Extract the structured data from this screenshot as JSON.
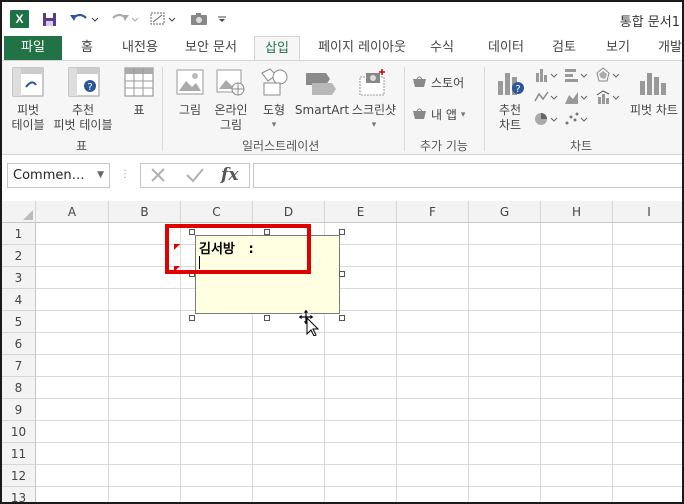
{
  "window": {
    "title": "통합 문서1"
  },
  "quick_access": {
    "icons": [
      "excel-logo",
      "save-icon",
      "undo-icon",
      "redo-icon",
      "shapes-icon",
      "camera-icon",
      "customize-icon"
    ]
  },
  "tabs": [
    "파일",
    "홈",
    "내전용",
    "보안 문서",
    "삽입",
    "페이지 레이아웃",
    "수식",
    "데이터",
    "검토",
    "보기",
    "개발"
  ],
  "active_tab": "삽입",
  "ribbon": {
    "groups": {
      "tables": "표",
      "illustrations": "일러스트레이션",
      "addins": "추가 기능",
      "charts": "차트"
    },
    "items": {
      "pivot_table_1": "피벗",
      "pivot_table_2": "테이블",
      "recommended_pivot_1": "추천",
      "recommended_pivot_2": "피벗 테이블",
      "table": "표",
      "picture": "그림",
      "online_picture_1": "온라인",
      "online_picture_2": "그림",
      "shapes": "도형",
      "smartart": "SmartArt",
      "screenshot": "스크린샷",
      "store": "스토어",
      "my_apps": "내 앱",
      "recommended_charts_1": "추천",
      "recommended_charts_2": "차트",
      "pivot_chart": "피벗 차트"
    }
  },
  "formula_bar": {
    "name_box": "Commen…",
    "fx_label": "fx",
    "formula": ""
  },
  "sheet": {
    "columns": [
      "A",
      "B",
      "C",
      "D",
      "E",
      "F",
      "G",
      "H",
      "I"
    ],
    "rows": [
      "1",
      "2",
      "3",
      "4",
      "5",
      "6",
      "7",
      "8",
      "9",
      "10",
      "11",
      "12",
      "13"
    ]
  },
  "comment": {
    "author": "김서방   :",
    "text": ""
  },
  "colors": {
    "excel_green": "#217346",
    "highlight": "#e00000",
    "comment_bg": "#ffffe1"
  }
}
